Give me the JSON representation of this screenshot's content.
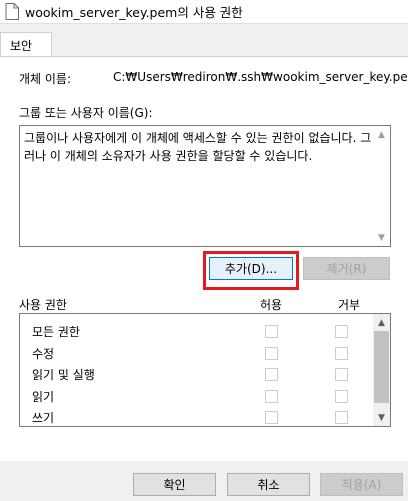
{
  "window": {
    "title": "wookim_server_key.pem의 사용 권한"
  },
  "tabs": [
    {
      "label": "보안"
    }
  ],
  "object": {
    "label": "개체 이름:",
    "path": "C:₩Users₩rediron₩.ssh₩wookim_server_key.pem"
  },
  "groups": {
    "label": "그룹 또는 사용자 이름(G):",
    "message": "그룹이나 사용자에게 이 개체에 액세스할 수 있는 권한이 없습니다. 그러나 이 개체의 소유자가 사용 권한을 할당할 수 있습니다."
  },
  "buttons": {
    "add": "추가(D)...",
    "remove": "제거(R)",
    "ok": "확인",
    "cancel": "취소",
    "apply": "적용(A)"
  },
  "permissions": {
    "header": "사용 권한",
    "allow_header": "허용",
    "deny_header": "거부",
    "rows": [
      {
        "name": "모든 권한",
        "allow": false,
        "deny": false
      },
      {
        "name": "수정",
        "allow": false,
        "deny": false
      },
      {
        "name": "읽기 및 실행",
        "allow": false,
        "deny": false
      },
      {
        "name": "읽기",
        "allow": false,
        "deny": false
      },
      {
        "name": "쓰기",
        "allow": false,
        "deny": false
      }
    ]
  },
  "colors": {
    "highlight": "#e41a1c",
    "focus": "#0078d7"
  }
}
